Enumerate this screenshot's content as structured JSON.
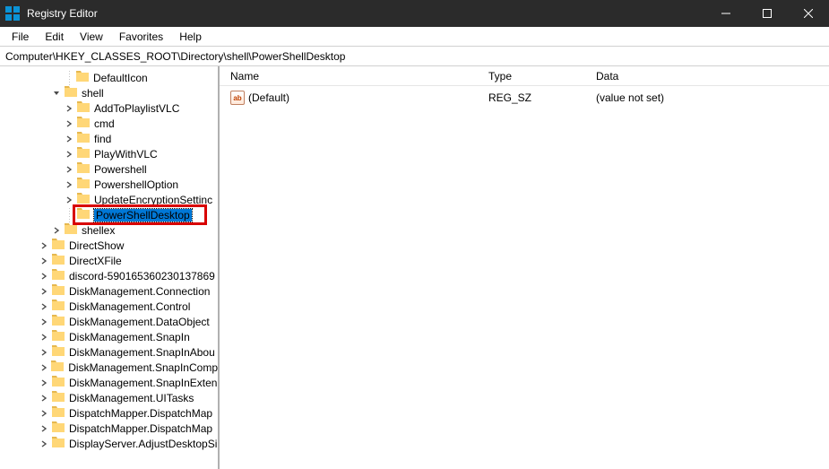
{
  "title": "Registry Editor",
  "menu": {
    "file": "File",
    "edit": "Edit",
    "view": "View",
    "favorites": "Favorites",
    "help": "Help"
  },
  "address": "Computer\\HKEY_CLASSES_ROOT\\Directory\\shell\\PowerShellDesktop",
  "tree": {
    "nodes": [
      {
        "indent": 70,
        "twisty": "none",
        "label": "DefaultIcon"
      },
      {
        "indent": 56,
        "twisty": "open",
        "label": "shell"
      },
      {
        "indent": 70,
        "twisty": "closed",
        "label": "AddToPlaylistVLC"
      },
      {
        "indent": 70,
        "twisty": "closed",
        "label": "cmd"
      },
      {
        "indent": 70,
        "twisty": "closed",
        "label": "find"
      },
      {
        "indent": 70,
        "twisty": "closed",
        "label": "PlayWithVLC"
      },
      {
        "indent": 70,
        "twisty": "closed",
        "label": "Powershell"
      },
      {
        "indent": 70,
        "twisty": "closed",
        "label": "PowershellOption"
      },
      {
        "indent": 70,
        "twisty": "closed",
        "label": "UpdateEncryptionSettinc"
      },
      {
        "indent": 70,
        "twisty": "none",
        "label": "PowerShellDesktop",
        "editing": true,
        "highlight": true
      },
      {
        "indent": 56,
        "twisty": "closed",
        "label": "shellex"
      },
      {
        "indent": 42,
        "twisty": "closed",
        "label": "DirectShow"
      },
      {
        "indent": 42,
        "twisty": "closed",
        "label": "DirectXFile"
      },
      {
        "indent": 42,
        "twisty": "closed",
        "label": "discord-590165360230137869"
      },
      {
        "indent": 42,
        "twisty": "closed",
        "label": "DiskManagement.Connection"
      },
      {
        "indent": 42,
        "twisty": "closed",
        "label": "DiskManagement.Control"
      },
      {
        "indent": 42,
        "twisty": "closed",
        "label": "DiskManagement.DataObject"
      },
      {
        "indent": 42,
        "twisty": "closed",
        "label": "DiskManagement.SnapIn"
      },
      {
        "indent": 42,
        "twisty": "closed",
        "label": "DiskManagement.SnapInAbou"
      },
      {
        "indent": 42,
        "twisty": "closed",
        "label": "DiskManagement.SnapInComp"
      },
      {
        "indent": 42,
        "twisty": "closed",
        "label": "DiskManagement.SnapInExten"
      },
      {
        "indent": 42,
        "twisty": "closed",
        "label": "DiskManagement.UITasks"
      },
      {
        "indent": 42,
        "twisty": "closed",
        "label": "DispatchMapper.DispatchMap"
      },
      {
        "indent": 42,
        "twisty": "closed",
        "label": "DispatchMapper.DispatchMap"
      },
      {
        "indent": 42,
        "twisty": "closed",
        "label": "DisplayServer.AdjustDesktopSi"
      }
    ]
  },
  "values": {
    "headers": {
      "name": "Name",
      "type": "Type",
      "data": "Data"
    },
    "rows": [
      {
        "name": "(Default)",
        "type": "REG_SZ",
        "data": "(value not set)"
      }
    ]
  }
}
